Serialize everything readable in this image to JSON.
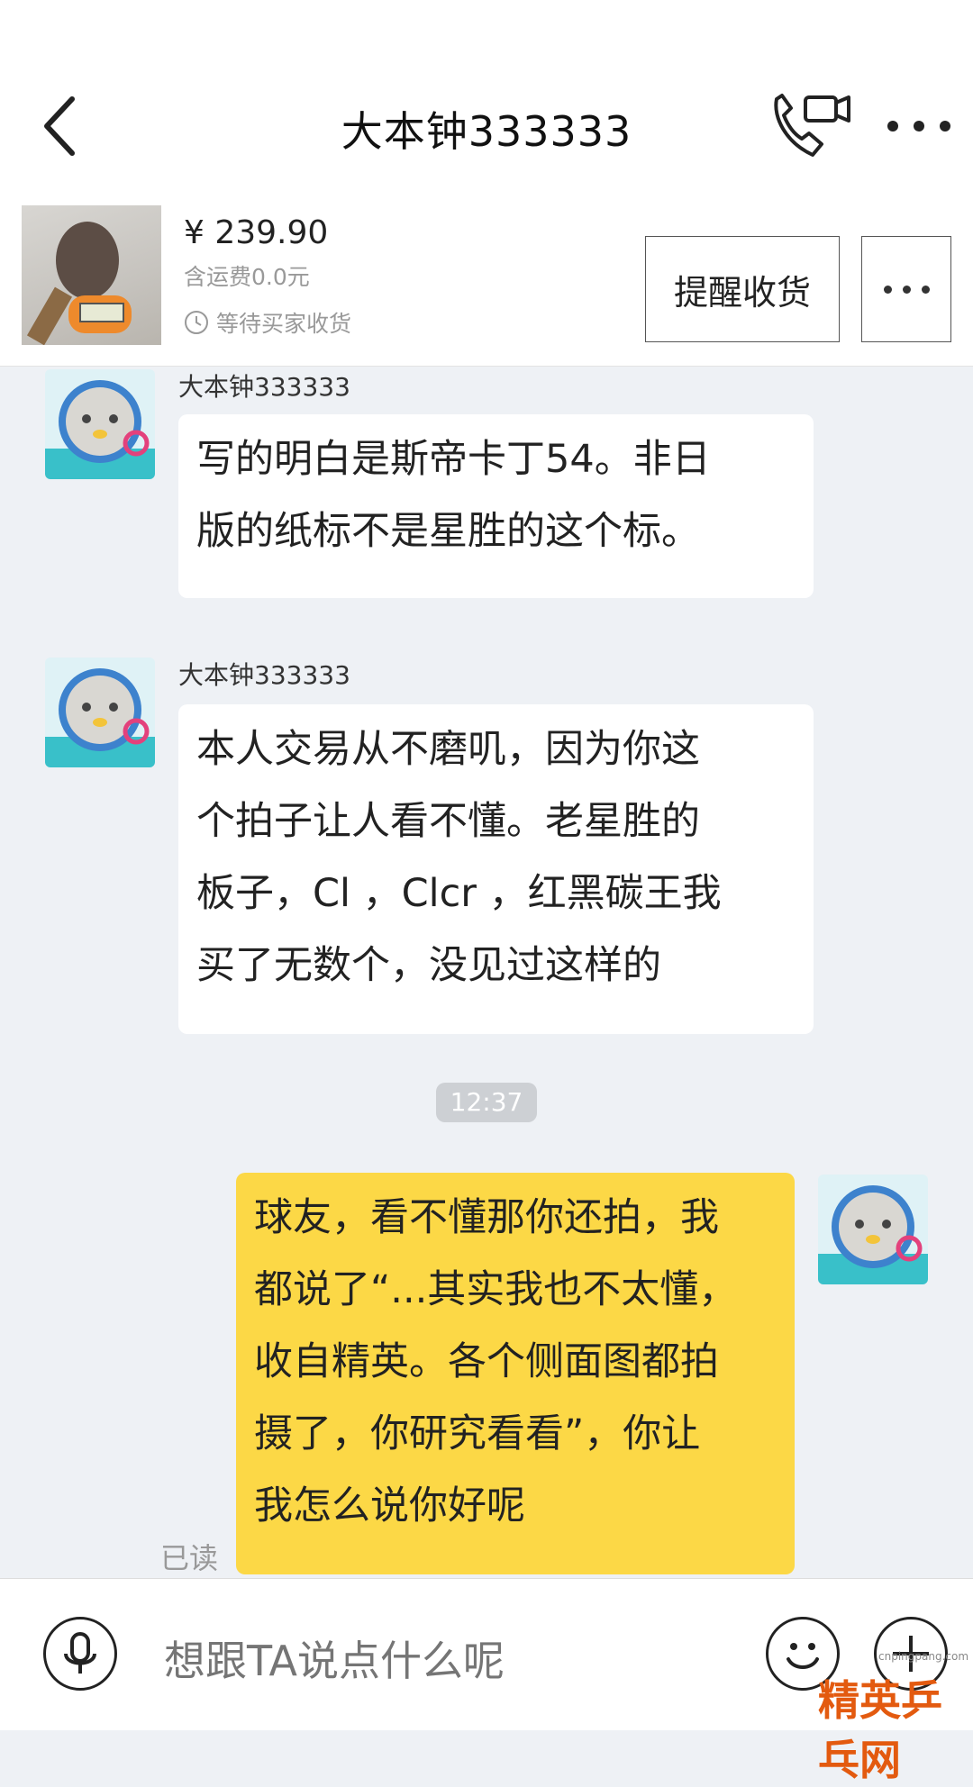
{
  "header": {
    "title": "大本钟333333",
    "back_icon": "chevron-left-icon",
    "call_icon": "phone-video-icon",
    "more_icon": "ellipsis-icon"
  },
  "order": {
    "price": "¥ 239.90",
    "shipping": "含运费0.0元",
    "status": "等待买家收货",
    "remind_button": "提醒收货",
    "more_icon": "ellipsis-icon"
  },
  "messages": [
    {
      "sender": "大本钟333333",
      "lines": [
        "写的明白是斯帝卡丁54。非日",
        "版的纸标不是星胜的这个标。"
      ]
    },
    {
      "sender": "大本钟333333",
      "lines": [
        "本人交易从不磨叽，因为你这",
        "个拍子让人看不懂。老星胜的",
        "板子，Cl ，Clcr ，红黑碳王我",
        "买了无数个，没见过这样的"
      ]
    },
    {
      "time": "12:37"
    },
    {
      "sender": "me",
      "lines": [
        "球友，看不懂那你还拍，我",
        "都说了“...其实我也不太懂，",
        "收自精英。各个侧面图都拍",
        "摄了，你研究看看”，你让",
        "我怎么说你好呢"
      ],
      "read": "已读"
    }
  ],
  "input": {
    "placeholder": "想跟TA说点什么呢"
  },
  "watermark": {
    "url": "cnpingpang.com",
    "text": "精英乒乓网"
  },
  "colors": {
    "accent_yellow": "#fcd846",
    "background": "#eef1f5"
  }
}
